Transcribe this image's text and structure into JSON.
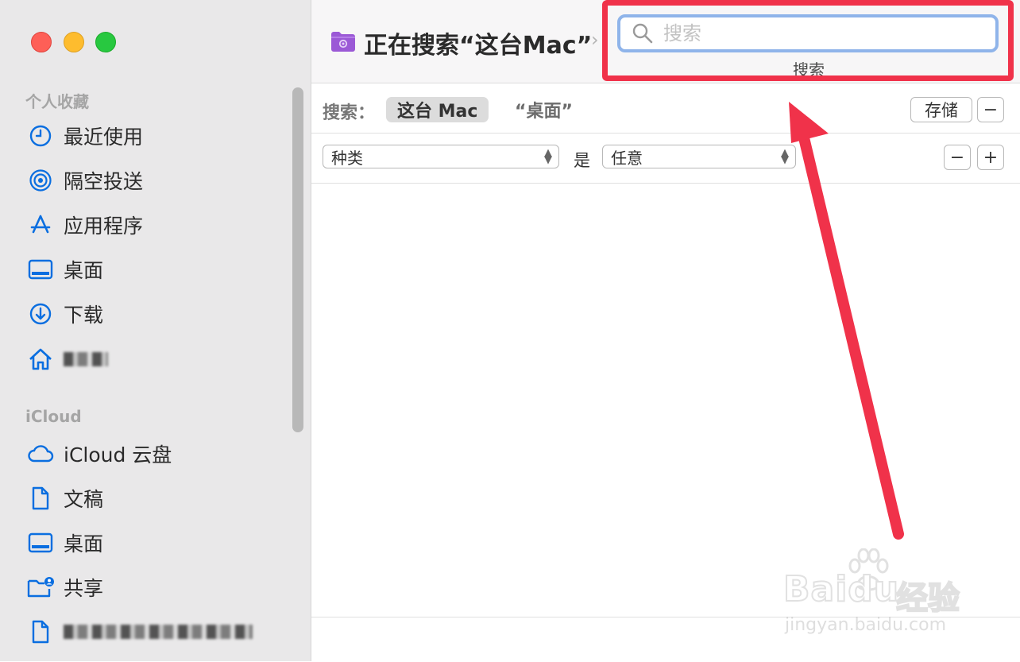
{
  "window": {
    "title": "正在搜索“这台Mac”",
    "breadcrumb_chevron": "›"
  },
  "sidebar": {
    "favorites_title": "个人收藏",
    "favorites": [
      {
        "label": "最近使用",
        "icon": "clock-icon"
      },
      {
        "label": "隔空投送",
        "icon": "airdrop-icon"
      },
      {
        "label": "应用程序",
        "icon": "applications-icon"
      },
      {
        "label": "桌面",
        "icon": "desktop-icon"
      },
      {
        "label": "下载",
        "icon": "download-icon"
      },
      {
        "label": "",
        "icon": "home-icon"
      }
    ],
    "icloud_title": "iCloud",
    "icloud": [
      {
        "label": "iCloud 云盘",
        "icon": "cloud-icon"
      },
      {
        "label": "文稿",
        "icon": "document-icon"
      },
      {
        "label": "桌面",
        "icon": "desktop-icon"
      },
      {
        "label": "共享",
        "icon": "shared-folder-icon"
      },
      {
        "label": "",
        "icon": "document-icon"
      }
    ]
  },
  "search": {
    "placeholder": "搜索",
    "value": "",
    "caption": "搜索"
  },
  "scope": {
    "label": "搜索：",
    "active": "这台 Mac",
    "other": "“桌面”",
    "save_label": "存储",
    "remove_label": "−"
  },
  "criteria": {
    "attribute": "种类",
    "operator": "是",
    "value": "任意",
    "remove_label": "−",
    "add_label": "+"
  },
  "watermark": {
    "logo": "Baidu",
    "cn": "经验",
    "url": "jingyan.baidu.com"
  },
  "colors": {
    "highlight": "#f0324a",
    "accent": "#0a6ee0",
    "search_focus": "#8fb4ea"
  }
}
